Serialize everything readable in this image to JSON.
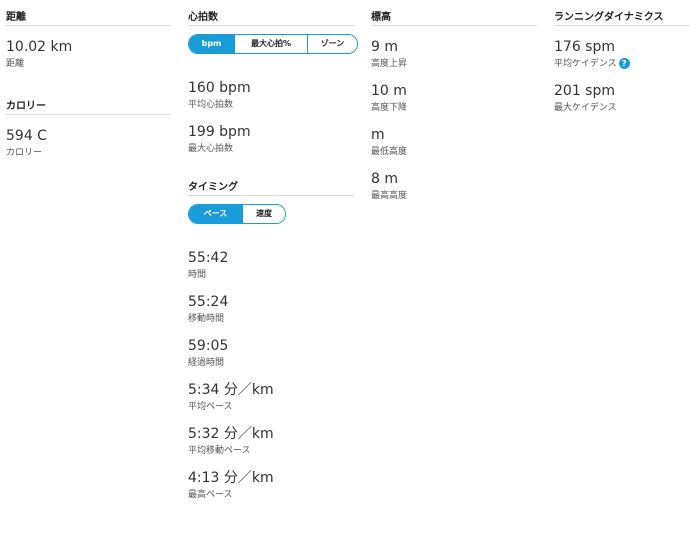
{
  "distance": {
    "title": "距離",
    "stats": [
      {
        "value": "10.02 km",
        "label": "距離"
      }
    ]
  },
  "calories": {
    "title": "カロリー",
    "stats": [
      {
        "value": "594 C",
        "label": "カロリー"
      }
    ]
  },
  "heart_rate": {
    "title": "心拍数",
    "toggle": {
      "selected": "bpm",
      "options": [
        "bpm",
        "最大心拍%",
        "ゾーン"
      ]
    },
    "stats": [
      {
        "value": "160 bpm",
        "label": "平均心拍数"
      },
      {
        "value": "199 bpm",
        "label": "最大心拍数"
      }
    ]
  },
  "timing": {
    "title": "タイミング",
    "toggle": {
      "selected": "ペース",
      "options": [
        "ペース",
        "速度"
      ]
    },
    "stats": [
      {
        "value": "55:42",
        "label": "時間"
      },
      {
        "value": "55:24",
        "label": "移動時間"
      },
      {
        "value": "59:05",
        "label": "経過時間"
      },
      {
        "value": "5:34 分／km",
        "label": "平均ペース"
      },
      {
        "value": "5:32 分／km",
        "label": "平均移動ペース"
      },
      {
        "value": "4:13 分／km",
        "label": "最高ペース"
      }
    ]
  },
  "elevation": {
    "title": "標高",
    "stats": [
      {
        "value": "9 m",
        "label": "高度上昇"
      },
      {
        "value": "10 m",
        "label": "高度下降"
      },
      {
        "value": "m",
        "label": "最低高度"
      },
      {
        "value": "8 m",
        "label": "最高高度"
      }
    ]
  },
  "running_dynamics": {
    "title": "ランニングダイナミクス",
    "stats": [
      {
        "value": "176 spm",
        "label": "平均ケイデンス",
        "help_icon": "question-circle-icon",
        "help_glyph": "?"
      },
      {
        "value": "201 spm",
        "label": "最大ケイデンス"
      }
    ]
  },
  "colors": {
    "accent": "#1a9cd8",
    "divider": "#dddddd",
    "text": "#333333"
  }
}
